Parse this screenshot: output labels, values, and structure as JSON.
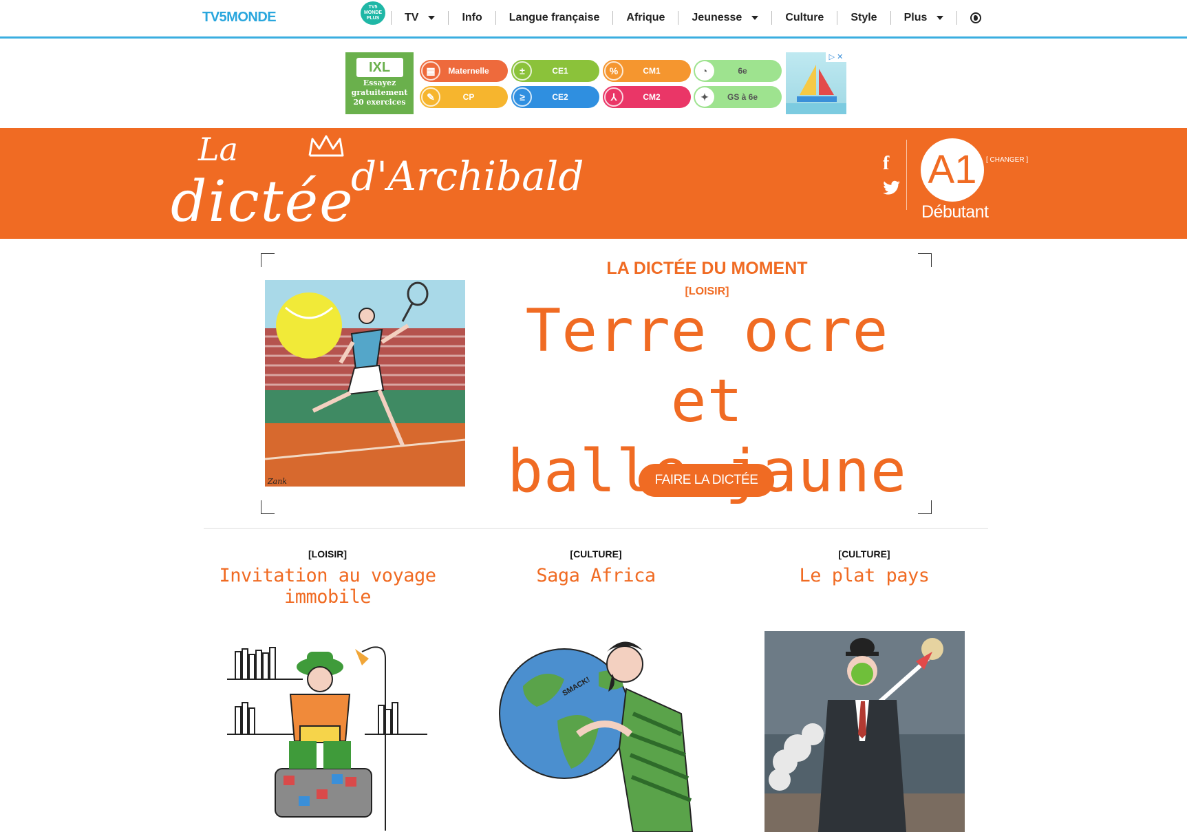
{
  "nav": {
    "logo": "TV5MONDE",
    "plus_logo": "TV5 MONDE PLUS",
    "items": [
      {
        "label": "TV",
        "dropdown": true
      },
      {
        "label": "Info",
        "dropdown": false
      },
      {
        "label": "Langue française",
        "dropdown": false
      },
      {
        "label": "Afrique",
        "dropdown": false
      },
      {
        "label": "Jeunesse",
        "dropdown": true
      },
      {
        "label": "Culture",
        "dropdown": false
      },
      {
        "label": "Style",
        "dropdown": false
      },
      {
        "label": "Plus",
        "dropdown": true
      }
    ],
    "globe_icon": "globe-icon",
    "accent": "#3aaee0"
  },
  "ad": {
    "brand": "IXL",
    "text": "Essayez gratuitement 20 exercices",
    "pills": [
      {
        "label": "Maternelle",
        "color": "#ee6a3c"
      },
      {
        "label": "CE1",
        "color": "#8bc23a"
      },
      {
        "label": "CM1",
        "color": "#f5962f"
      },
      {
        "label": "6e",
        "color": "#9ee38f"
      },
      {
        "label": "CP",
        "color": "#f6b52e"
      },
      {
        "label": "CE2",
        "color": "#2f8fe0"
      },
      {
        "label": "CM2",
        "color": "#ea3667"
      },
      {
        "label": "GS à 6e",
        "color": "#9ee38f"
      }
    ],
    "close": "▷ ✕"
  },
  "banner": {
    "la": "La",
    "dictee": "dictée",
    "archibald": "d'Archibald",
    "level": "A1",
    "level_label": "Débutant",
    "changer": "[ CHANGER ]",
    "color": "#f06b23"
  },
  "featured": {
    "heading": "LA DICTÉE DU MOMENT",
    "category": "[LOISIR]",
    "title_line1": "Terre ocre et",
    "title_line2": "balle jaune",
    "cta": "FAIRE LA DICTÉE",
    "signature": "Zank"
  },
  "cards": [
    {
      "category": "[LOISIR]",
      "title": "Invitation au voyage immobile"
    },
    {
      "category": "[CULTURE]",
      "title": "Saga Africa"
    },
    {
      "category": "[CULTURE]",
      "title": "Le plat pays"
    }
  ]
}
